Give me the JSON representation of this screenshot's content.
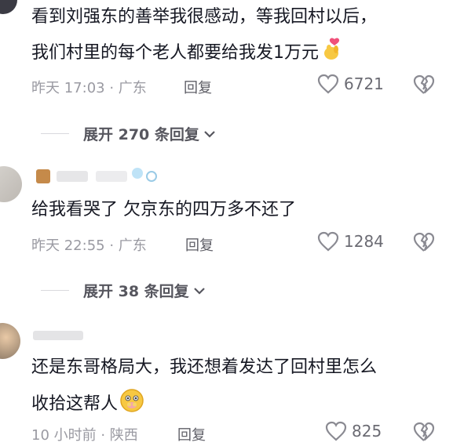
{
  "comments": [
    {
      "text_line1": "看到刘强东的善举我很感动，等我回村以后，",
      "text_line2": "我们村里的每个老人都要给我发1万元",
      "emoji": "finger-heart-emoji",
      "time": "昨天 17:03 · 广东",
      "reply_label": "回复",
      "likes": "6721",
      "expand_label": "展开 270 条回复"
    },
    {
      "text_line1": "给我看哭了 欠京东的四万多不还了",
      "time": "昨天 22:55 · 广东",
      "reply_label": "回复",
      "likes": "1284",
      "expand_label": "展开 38 条回复"
    },
    {
      "text_line1": "还是东哥格局大，我还想着发达了回村里怎么",
      "text_line2": "收拾这帮人",
      "emoji": "hugging-face-emoji",
      "time": "10 小时前 · 陕西",
      "reply_label": "回复",
      "likes": "825"
    }
  ],
  "icons": {
    "like": "heart-outline-icon",
    "dislike": "broken-heart-icon",
    "expand": "chevron-down-icon"
  },
  "colors": {
    "text": "#161823",
    "meta": "#9a9aa2",
    "accent_emoji": "#f5b731"
  }
}
